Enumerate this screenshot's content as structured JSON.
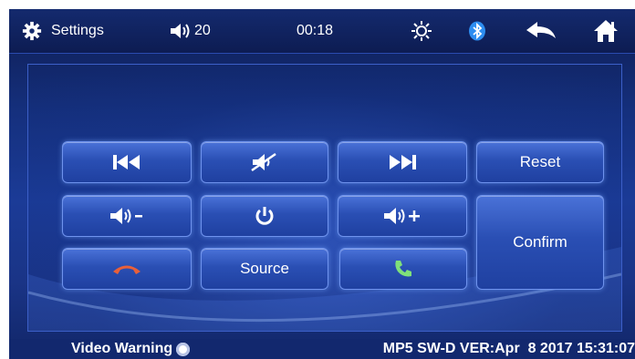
{
  "topbar": {
    "settings_label": "Settings",
    "volume_value": "20",
    "clock": "00:18",
    "icons": [
      "settings-gear-icon",
      "volume-icon",
      "brightness-icon",
      "bluetooth-icon",
      "back-arrow-icon",
      "home-icon"
    ]
  },
  "buttons": {
    "prev_icon": "previous-track-icon",
    "mute_icon": "mute-icon",
    "next_icon": "next-track-icon",
    "reset_label": "Reset",
    "vol_down_icon": "volume-down-icon",
    "power_icon": "power-icon",
    "vol_up_icon": "volume-up-icon",
    "confirm_label": "Confirm",
    "hangup_icon": "hang-up-phone-icon",
    "source_label": "Source",
    "answer_icon": "answer-phone-icon"
  },
  "colors": {
    "hangup": "#e8603a",
    "answer": "#7fe07a",
    "bluetooth": "#2d8df0"
  },
  "footer": {
    "video_warning_label": "Video Warning",
    "version_text": "MP5 SW-D VER:Apr  8 2017 15:31:07"
  }
}
